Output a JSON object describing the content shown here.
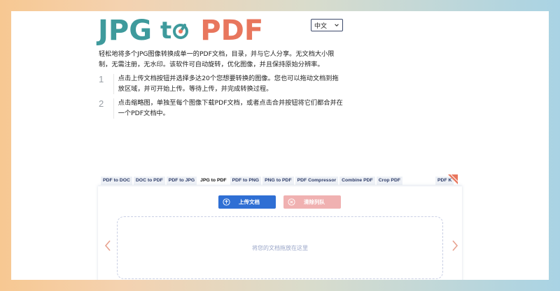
{
  "logo": {
    "jpg": "JPG",
    "to": "t",
    "pdf": "PDF"
  },
  "language": {
    "selected": "中文"
  },
  "description": "轻松地将多个JPG图像转换成单一的PDF文档，目录，并与它人分享。无文档大小限制，无需注册，无水印。该软件可自动旋转，优化图像，并且保持原始分辨率。",
  "steps": [
    {
      "num": "1",
      "text": "点击上传文档按钮并选择多达20个您想要转换的图像。您也可以拖动文档到拖放区域，并可开始上传。等待上传，并完成转换过程。"
    },
    {
      "num": "2",
      "text": "点击缩略图，单独至每个图像下载PDF文档，或者点击合并按钮将它们都合并在一个PDF文档中。"
    }
  ],
  "tabs": [
    "PDF to DOC",
    "DOC to PDF",
    "PDF to JPG",
    "JPG to PDF",
    "PDF to PNG",
    "PNG to PDF",
    "PDF Compressor",
    "Combine PDF",
    "Crop PDF"
  ],
  "tab_last": "PDF K",
  "active_tab": "JPG to PDF",
  "buttons": {
    "upload": "上传文档",
    "clear": "清除列队"
  },
  "dropzone_text": "将您的文档拖放在这里",
  "colors": {
    "teal": "#3e9a9c",
    "coral": "#e8765d",
    "upload_blue": "#2f6fd4",
    "clear_pink": "#f0b1b1"
  }
}
